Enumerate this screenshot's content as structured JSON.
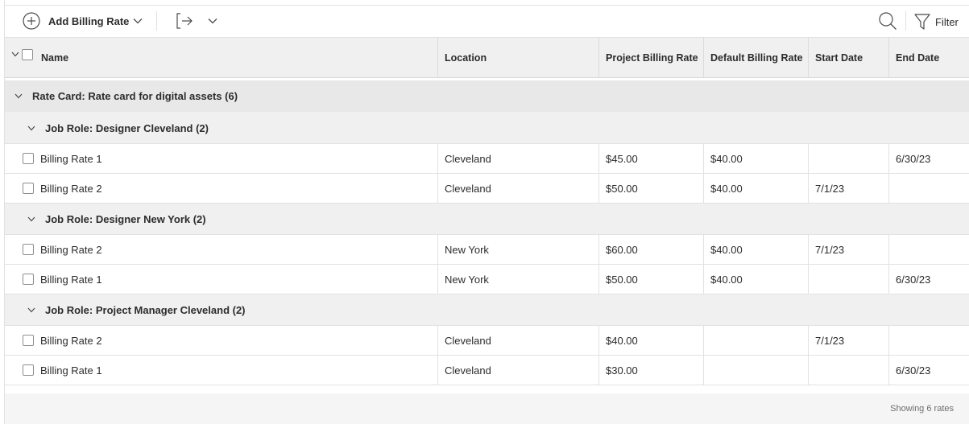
{
  "toolbar": {
    "add_label": "Add Billing Rate",
    "filter_label": "Filter"
  },
  "columns": [
    "Name",
    "Location",
    "Project Billing Rate",
    "Default Billing Rate",
    "Start Date",
    "End Date"
  ],
  "rate_card": {
    "label": "Rate Card: Rate card for digital assets (6)"
  },
  "groups": [
    {
      "label": "Job Role: Designer Cleveland (2)",
      "rows": [
        {
          "name": "Billing Rate 1",
          "location": "Cleveland",
          "project_rate": "$45.00",
          "default_rate": "$40.00",
          "start": "",
          "end": "6/30/23"
        },
        {
          "name": "Billing Rate 2",
          "location": "Cleveland",
          "project_rate": "$50.00",
          "default_rate": "$40.00",
          "start": "7/1/23",
          "end": ""
        }
      ]
    },
    {
      "label": "Job Role: Designer New York (2)",
      "rows": [
        {
          "name": "Billing Rate 2",
          "location": "New York",
          "project_rate": "$60.00",
          "default_rate": "$40.00",
          "start": "7/1/23",
          "end": ""
        },
        {
          "name": "Billing Rate 1",
          "location": "New York",
          "project_rate": "$50.00",
          "default_rate": "$40.00",
          "start": "",
          "end": "6/30/23"
        }
      ]
    },
    {
      "label": "Job Role: Project Manager Cleveland (2)",
      "rows": [
        {
          "name": "Billing Rate 2",
          "location": "Cleveland",
          "project_rate": "$40.00",
          "default_rate": "",
          "start": "7/1/23",
          "end": ""
        },
        {
          "name": "Billing Rate 1",
          "location": "Cleveland",
          "project_rate": "$30.00",
          "default_rate": "",
          "start": "",
          "end": "6/30/23"
        }
      ]
    }
  ],
  "footer": {
    "count_text": "Showing 6 rates"
  },
  "icons": {
    "add": "plus-circle-icon",
    "export": "export-icon",
    "search": "search-icon",
    "filter": "filter-icon",
    "chevron": "chevron-down-icon"
  },
  "colors": {
    "header_bg": "#f0f0f0",
    "rate_card_bg": "#e8e8e8",
    "job_role_bg": "#f0f0f0",
    "text": "#2c2c2c"
  }
}
